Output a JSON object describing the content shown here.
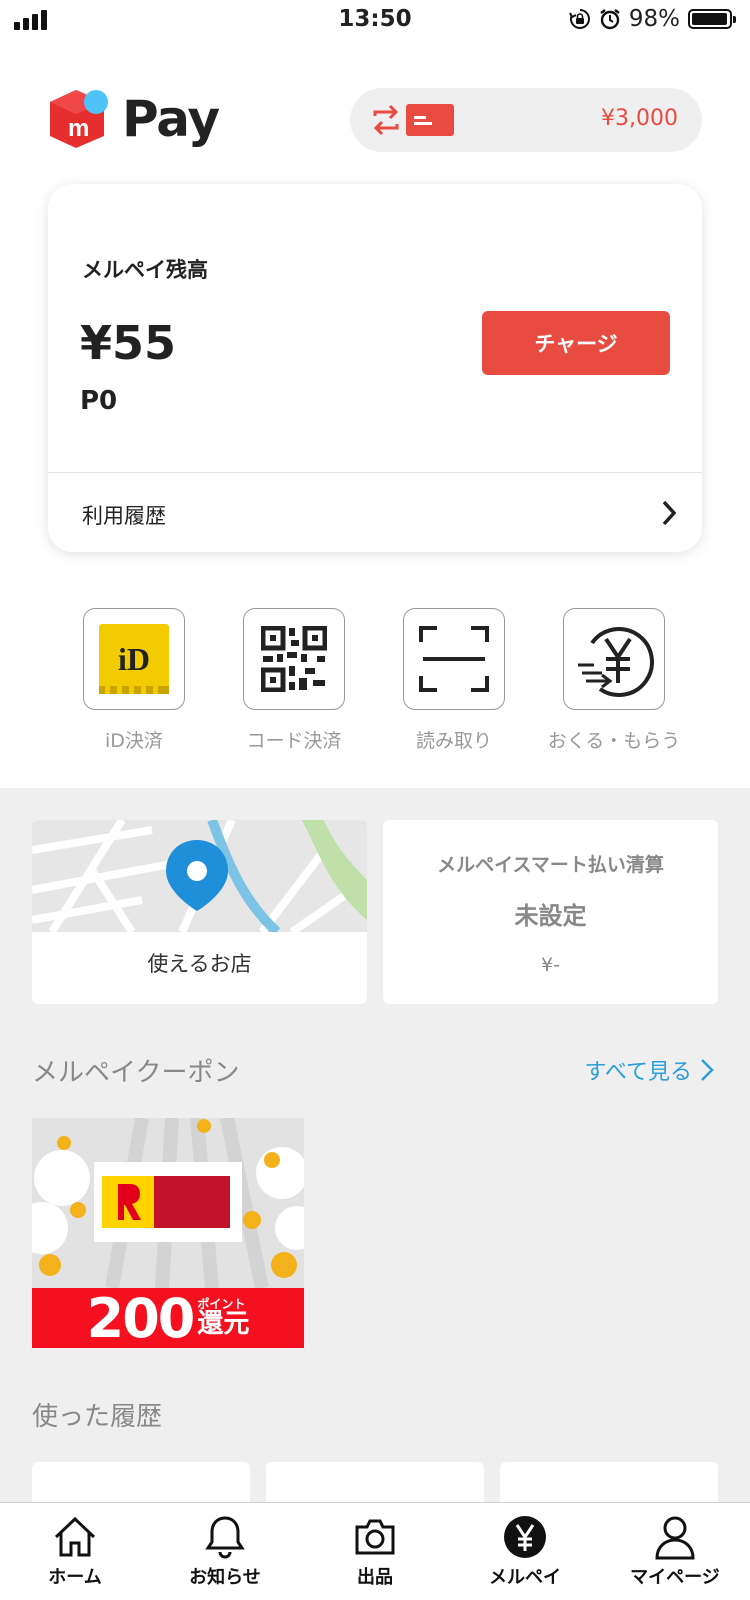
{
  "status_bar": {
    "time": "13:50",
    "battery": "98%",
    "battery_level": 0.98
  },
  "header": {
    "logo_text": "Pay",
    "pill_amount": "¥3,000"
  },
  "balance_card": {
    "title": "メルペイ残高",
    "balance": "¥55",
    "points": "P0",
    "charge_label": "チャージ",
    "history_label": "利用履歴"
  },
  "actions": [
    {
      "label": "iD決済",
      "icon": "id-icon"
    },
    {
      "label": "コード決済",
      "icon": "qr-code-icon"
    },
    {
      "label": "読み取り",
      "icon": "scan-icon"
    },
    {
      "label": "おくる・もらう",
      "icon": "send-receive-icon"
    }
  ],
  "shop_card": {
    "label": "使えるお店"
  },
  "smart_card": {
    "title": "メルペイスマート払い清算",
    "status": "未設定",
    "amount": "¥-"
  },
  "coupons": {
    "title": "メルペイクーポン",
    "see_all": "すべて見る",
    "coupon": {
      "amount": "200",
      "unit_top": "ポイント",
      "unit_bottom": "還元"
    }
  },
  "used_history": {
    "title": "使った履歴"
  },
  "tabs": [
    {
      "label": "ホーム",
      "icon": "home-icon"
    },
    {
      "label": "お知らせ",
      "icon": "bell-icon"
    },
    {
      "label": "出品",
      "icon": "camera-icon"
    },
    {
      "label": "メルペイ",
      "icon": "yen-icon"
    },
    {
      "label": "マイページ",
      "icon": "person-icon"
    }
  ],
  "colors": {
    "accent": "#e84b3f",
    "link": "#2d9fd8",
    "coupon_red": "#f5101f",
    "logo_blue": "#4fc3f7"
  }
}
